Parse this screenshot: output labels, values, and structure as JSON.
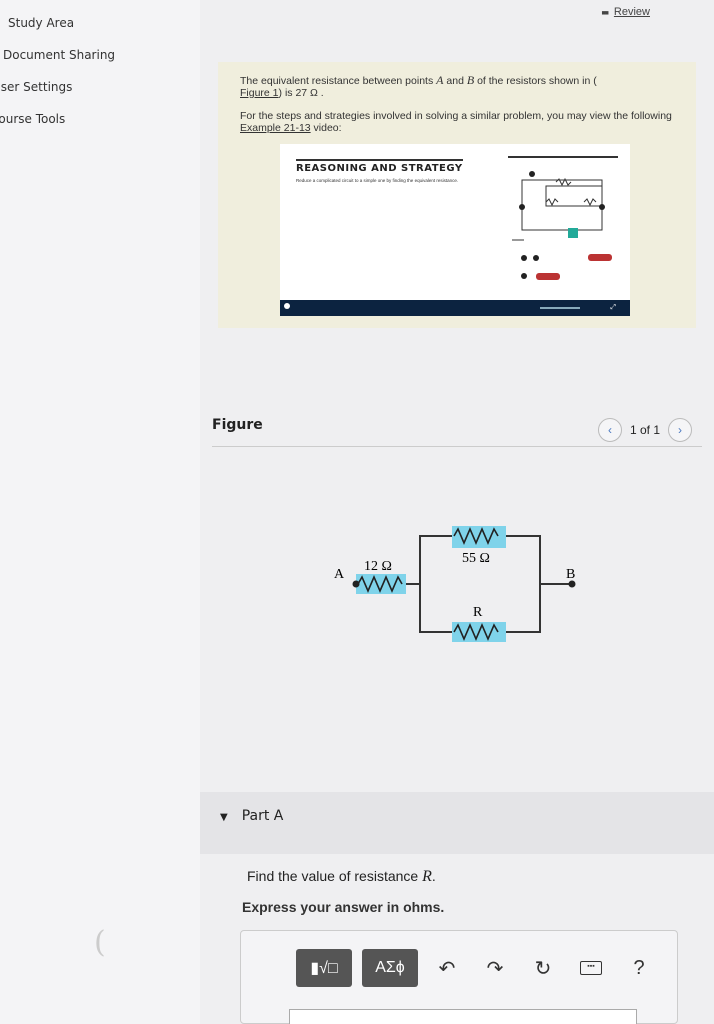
{
  "sidebar": {
    "items": [
      {
        "label": "Study Area"
      },
      {
        "label": "Document Sharing"
      },
      {
        "label": "User Settings"
      },
      {
        "label": "Course Tools"
      }
    ]
  },
  "header": {
    "review_label": "Review"
  },
  "hint": {
    "p1_a": "The equivalent resistance between points ",
    "p1_A": "A",
    "p1_b": " and ",
    "p1_B": "B",
    "p1_c": " of the resistors shown in (",
    "p1_link": "Figure 1",
    "p1_d": ") is 27 Ω .",
    "p2_a": "For the steps and strategies involved in solving a similar problem, you may view the following ",
    "p2_link": "Example 21-13",
    "p2_b": " video:",
    "video": {
      "title": "REASONING AND STRATEGY",
      "subtitle": "Reduce a complicated circuit to a simple one by finding the equivalent resistance.",
      "series_text": "and   are in series",
      "parallel_text": "and   are in parallel"
    }
  },
  "figure": {
    "label": "Figure",
    "pager": "1 of 1",
    "prev_icon": "chevron-left-icon",
    "next_icon": "chevron-right-icon",
    "circuit": {
      "point_a": "A",
      "point_b": "B",
      "r_series": "12 Ω",
      "r_top": "55 Ω",
      "r_bottom": "R"
    }
  },
  "part_a": {
    "label": "Part A",
    "question_prefix": "Find the value of resistance ",
    "question_var": "R",
    "question_suffix": ".",
    "instruction": "Express your answer in ohms."
  },
  "toolbar": {
    "template_label": "▮√□",
    "greek_label": "ΑΣϕ",
    "undo_icon": "undo-icon",
    "redo_icon": "redo-icon",
    "reset_icon": "reset-icon",
    "keyboard_icon": "keyboard-icon",
    "help_label": "?"
  },
  "colors": {
    "resistor_highlight": "#7fd3ea",
    "hint_bg": "#f0eedd",
    "video_bar": "#0c2340",
    "link_blue": "#4a78c0"
  }
}
